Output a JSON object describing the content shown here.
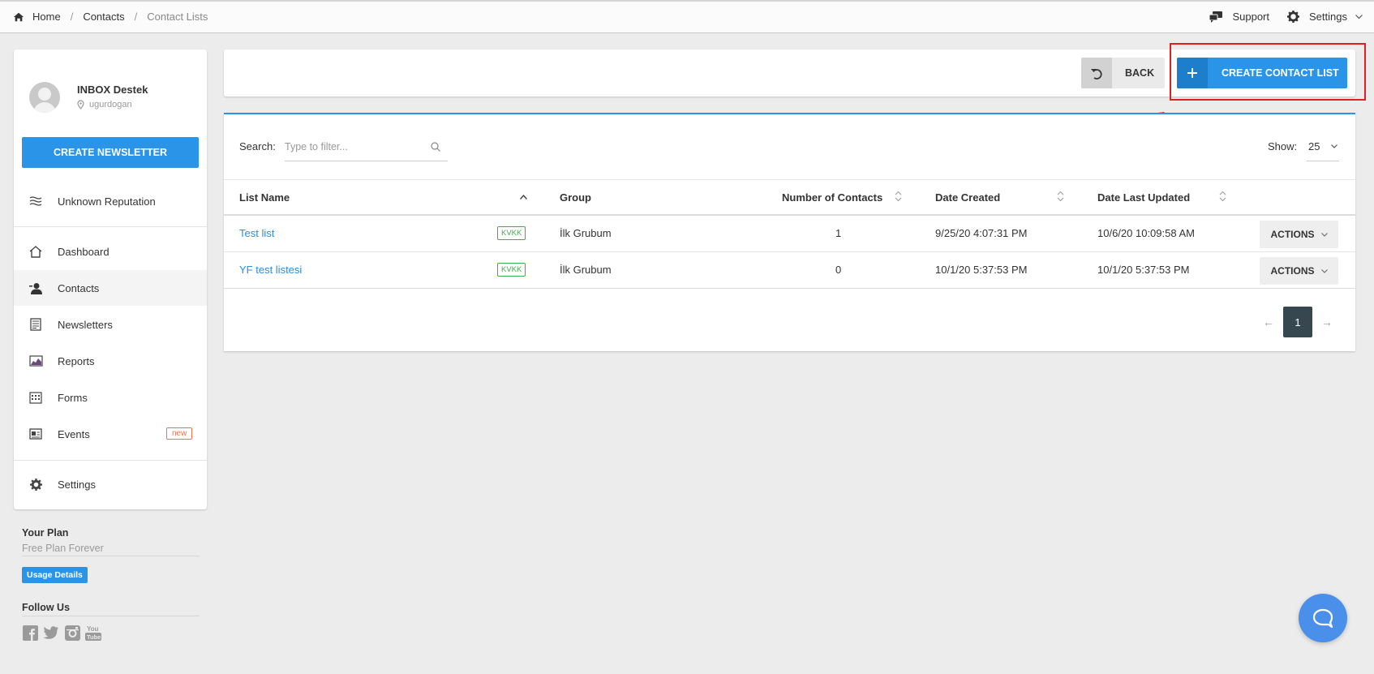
{
  "breadcrumb": {
    "home": "Home",
    "contacts": "Contacts",
    "current": "Contact Lists"
  },
  "topnav": {
    "support": "Support",
    "settings": "Settings"
  },
  "user": {
    "name": "INBOX Destek",
    "username": "ugurdogan"
  },
  "sidebar": {
    "create_newsletter": "CREATE NEWSLETTER",
    "reputation": "Unknown Reputation",
    "items": [
      {
        "label": "Dashboard",
        "icon": "home-icon"
      },
      {
        "label": "Contacts",
        "icon": "contacts-icon",
        "active": true
      },
      {
        "label": "Newsletters",
        "icon": "newsletter-icon"
      },
      {
        "label": "Reports",
        "icon": "reports-icon"
      },
      {
        "label": "Forms",
        "icon": "forms-icon"
      },
      {
        "label": "Events",
        "icon": "events-icon",
        "badge": "new"
      }
    ],
    "settings": "Settings"
  },
  "plan": {
    "heading": "Your Plan",
    "name": "Free Plan Forever",
    "usage_button": "Usage Details"
  },
  "follow": {
    "heading": "Follow Us"
  },
  "actionbar": {
    "back": "BACK",
    "create": "CREATE CONTACT LIST"
  },
  "table": {
    "search_label": "Search:",
    "search_placeholder": "Type to filter...",
    "show_label": "Show:",
    "show_value": "25",
    "columns": [
      "List Name",
      "Group",
      "Number of Contacts",
      "Date Created",
      "Date Last Updated"
    ],
    "rows": [
      {
        "name": "Test list",
        "tag": "KVKK",
        "group": "İlk Grubum",
        "contacts": "1",
        "created": "9/25/20 4:07:31 PM",
        "updated": "10/6/20 10:09:58 AM",
        "action": "ACTIONS"
      },
      {
        "name": "YF test listesi",
        "tag": "KVKK",
        "group": "İlk Grubum",
        "contacts": "0",
        "created": "10/1/20 5:37:53 PM",
        "updated": "10/1/20 5:37:53 PM",
        "action": "ACTIONS"
      }
    ],
    "pagination": {
      "prev": "←",
      "current": "1",
      "next": "→"
    }
  },
  "colors": {
    "accent": "#2a95e8",
    "highlight": "#e02020",
    "tag": "#3fae49"
  }
}
